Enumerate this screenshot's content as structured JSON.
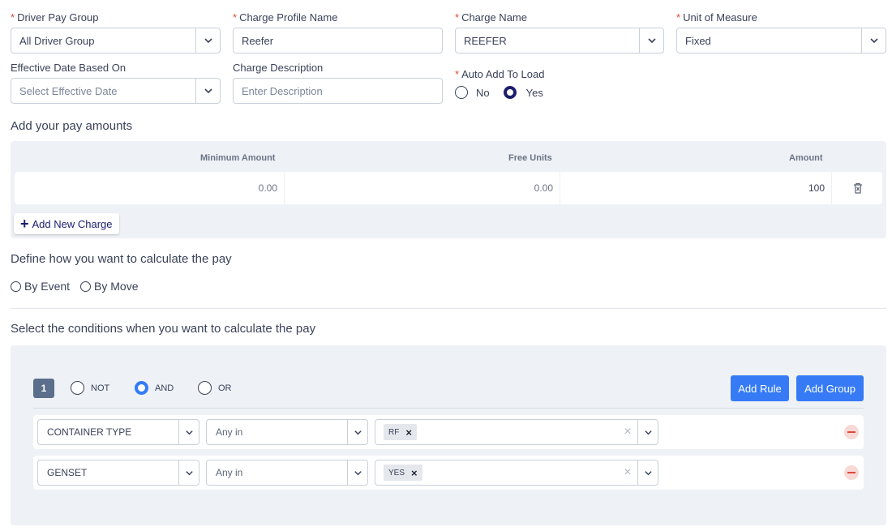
{
  "fields": {
    "driver_pay_group": {
      "label": "Driver Pay Group",
      "required": "*",
      "value": "All Driver Group"
    },
    "charge_profile_name": {
      "label": "Charge Profile Name",
      "required": "*",
      "value": "Reefer"
    },
    "charge_name": {
      "label": "Charge Name",
      "required": "*",
      "value": "REEFER"
    },
    "unit_of_measure": {
      "label": "Unit of Measure",
      "required": "*",
      "value": "Fixed"
    },
    "effective_date": {
      "label": "Effective Date Based On",
      "placeholder": "Select Effective Date"
    },
    "charge_description": {
      "label": "Charge Description",
      "placeholder": "Enter Description"
    },
    "auto_add": {
      "label": "Auto Add To Load",
      "required": "*",
      "options": [
        "No",
        "Yes"
      ],
      "selected": "Yes"
    }
  },
  "pay_amounts": {
    "title": "Add your pay amounts",
    "headers": [
      "Minimum Amount",
      "Free Units",
      "Amount"
    ],
    "rows": [
      {
        "minimum": "0.00",
        "free_units": "0.00",
        "amount": "100"
      }
    ],
    "add_button": "Add New Charge"
  },
  "calculate": {
    "title": "Define how you want to calculate the pay",
    "options": [
      "By Event",
      "By Move"
    ]
  },
  "conditions": {
    "title": "Select the conditions when you want to calculate the pay",
    "group_number": "1",
    "operators": [
      "NOT",
      "AND",
      "OR"
    ],
    "selected_operator": "AND",
    "add_rule": "Add Rule",
    "add_group": "Add Group",
    "rules": [
      {
        "field": "CONTAINER TYPE",
        "operator": "Any in",
        "values": [
          "RF"
        ]
      },
      {
        "field": "GENSET",
        "operator": "Any in",
        "values": [
          "YES"
        ]
      }
    ]
  },
  "colors": {
    "primary": "#367bf5",
    "navy": "#1c1e6e",
    "panel": "#eef1f6",
    "required": "#e0483a"
  },
  "icons": [
    "chevron-down-icon",
    "plus-icon",
    "trash-icon",
    "close-icon",
    "remove-icon"
  ]
}
